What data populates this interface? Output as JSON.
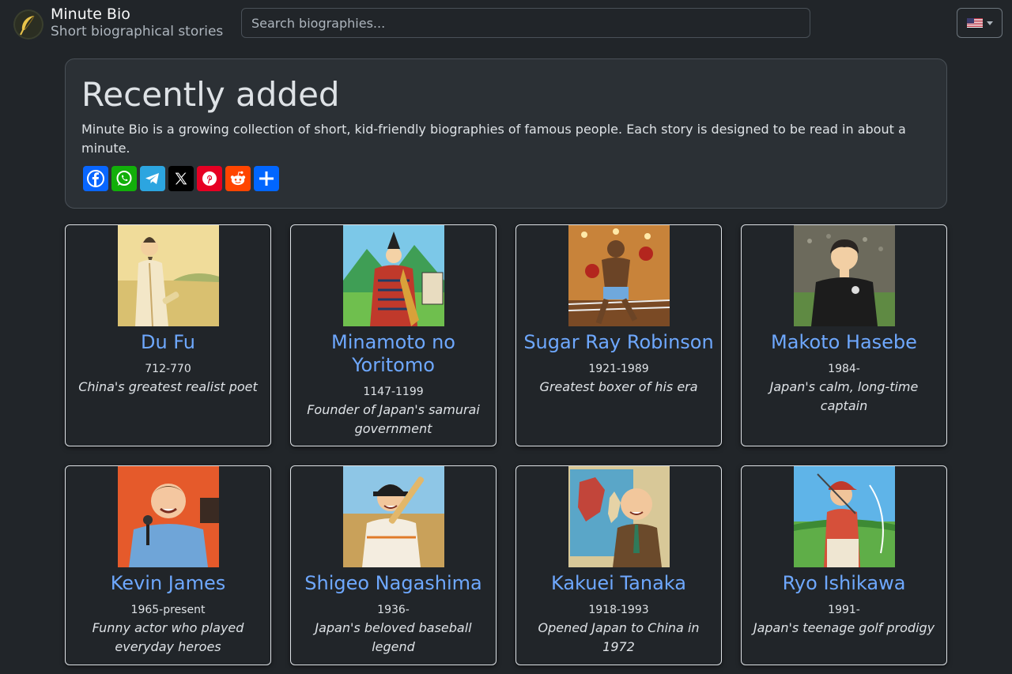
{
  "header": {
    "title": "Minute Bio",
    "subtitle": "Short biographical stories",
    "logo_icon": "feather-icon",
    "search_placeholder": "Search biographies...",
    "language_icon": "us-flag-icon"
  },
  "hero": {
    "title": "Recently added",
    "description": "Minute Bio is a growing collection of short, kid-friendly biographies of famous people. Each story is designed to be read in about a minute.",
    "share_buttons": [
      {
        "name": "facebook",
        "color": "#0866ff"
      },
      {
        "name": "whatsapp",
        "color": "#12af0a"
      },
      {
        "name": "telegram",
        "color": "#2ca5e0"
      },
      {
        "name": "x",
        "color": "#000000"
      },
      {
        "name": "pinterest",
        "color": "#e60023"
      },
      {
        "name": "reddit",
        "color": "#ff4500"
      },
      {
        "name": "share",
        "color": "#0166ff"
      }
    ]
  },
  "cards": [
    {
      "name": "Du Fu",
      "dates": "712-770",
      "tagline": "China's greatest realist poet"
    },
    {
      "name": "Minamoto no Yoritomo",
      "dates": "1147-1199",
      "tagline": "Founder of Japan's samurai government"
    },
    {
      "name": "Sugar Ray Robinson",
      "dates": "1921-1989",
      "tagline": "Greatest boxer of his era"
    },
    {
      "name": "Makoto Hasebe",
      "dates": "1984-",
      "tagline": "Japan's calm, long-time captain"
    },
    {
      "name": "Kevin James",
      "dates": "1965-present",
      "tagline": "Funny actor who played everyday heroes"
    },
    {
      "name": "Shigeo Nagashima",
      "dates": "1936-",
      "tagline": "Japan's beloved baseball legend"
    },
    {
      "name": "Kakuei Tanaka",
      "dates": "1918-1993",
      "tagline": "Opened Japan to China in 1972"
    },
    {
      "name": "Ryo Ishikawa",
      "dates": "1991-",
      "tagline": "Japan's teenage golf prodigy"
    }
  ],
  "theme": {
    "background": "#212529",
    "link": "#6ea8fe",
    "panel": "#2b3035"
  }
}
